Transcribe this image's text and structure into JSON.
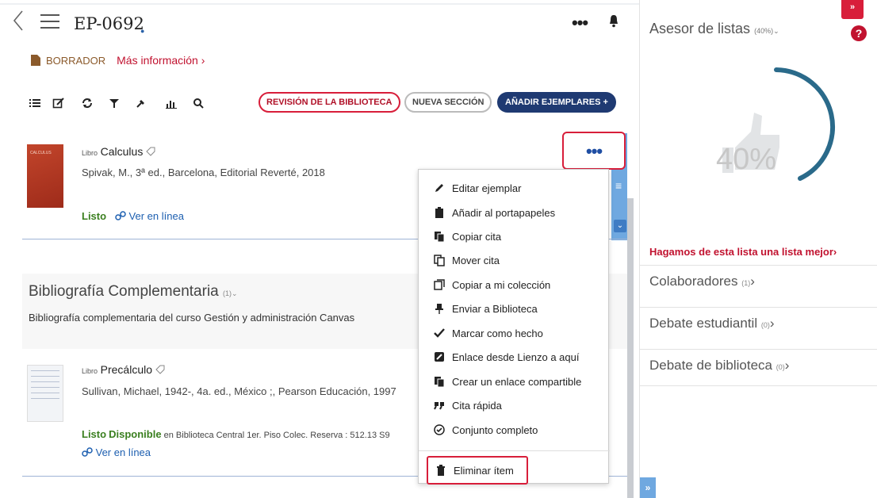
{
  "header": {
    "title": "EP-0692",
    "title_marker": "●",
    "more_label": "•••"
  },
  "status": {
    "draft_label": "BORRADOR",
    "more_info_label": "Más información",
    "more_info_chevron": "›"
  },
  "toolbar": {
    "icons": [
      "list-icon",
      "edit-icon",
      "sync-icon",
      "filter-icon",
      "pin-icon",
      "stats-icon",
      "search-icon"
    ],
    "review_label": "REVISIÓN DE LA BIBLIOTECA",
    "new_section_label": "NUEVA SECCIÓN",
    "add_items_label": "AÑADIR EJEMPLARES",
    "add_plus": "+"
  },
  "items": [
    {
      "type": "Libro",
      "title": "Calculus",
      "citation": "Spivak, M., 3ª ed., Barcelona, Editorial Reverté, 2018",
      "status": "Listo",
      "online": "Ver en línea",
      "cover_text": "CALCULUS"
    },
    {
      "type": "Libro",
      "title": "Precálculo",
      "citation": "Sullivan, Michael, 1942-, 4a. ed., México ;, Pearson Educación, 1997",
      "status": "Listo",
      "availability": "Disponible",
      "location": "en Biblioteca Central 1er. Piso Colec. Reserva : 512.13 S9",
      "online": "Ver en línea"
    }
  ],
  "item_more_label": "•••",
  "section": {
    "title": "Bibliografía Complementaria",
    "count": "(1)",
    "chevron": "⌄",
    "description": "Bibliografía complementaria del curso Gestión y administración Canvas"
  },
  "context_menu": {
    "items": [
      {
        "label": "Editar ejemplar",
        "icon": "pencil-icon"
      },
      {
        "label": "Añadir al portapapeles",
        "icon": "clipboard-icon"
      },
      {
        "label": "Copiar cita",
        "icon": "copy-icon"
      },
      {
        "label": "Mover cita",
        "icon": "move-icon"
      },
      {
        "label": "Copiar a mi colección",
        "icon": "collection-icon"
      },
      {
        "label": "Enviar a Biblioteca",
        "icon": "pushpin-icon"
      },
      {
        "label": "Marcar como hecho",
        "icon": "checkmark-icon"
      },
      {
        "label": "Enlace desde Lienzo a aquí",
        "icon": "canvas-link-icon"
      },
      {
        "label": "Crear un enlace compartible",
        "icon": "share-link-icon"
      },
      {
        "label": "Cita rápida",
        "icon": "quote-icon"
      },
      {
        "label": "Conjunto completo",
        "icon": "circle-check-icon"
      }
    ],
    "delete_label": "Eliminar ítem"
  },
  "advisor": {
    "title": "Asesor de listas",
    "title_pct": "(40%)",
    "percent": 40,
    "percent_label": "40%",
    "improve_label": "Hagamos de esta lista una lista mejor",
    "improve_chevron": "›",
    "rows": [
      {
        "label": "Colaboradores",
        "count": "(1)",
        "chevron": "›"
      },
      {
        "label": "Debate estudiantil",
        "count": "(0)",
        "chevron": "›"
      },
      {
        "label": "Debate de biblioteca",
        "count": "(0)",
        "chevron": "›"
      }
    ],
    "colors": {
      "accent": "#d81e3a",
      "gauge": "#2a6a8a",
      "brand_blue": "#1f3a72"
    }
  }
}
